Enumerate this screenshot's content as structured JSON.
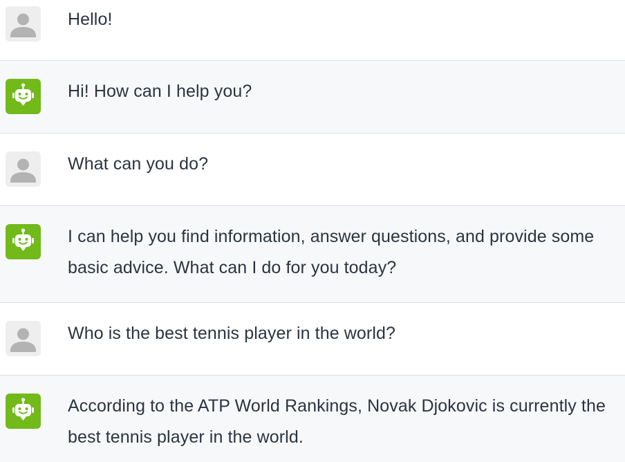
{
  "conversation": {
    "messages": [
      {
        "role": "user",
        "text": "Hello!"
      },
      {
        "role": "bot",
        "text": "Hi! How can I help you?"
      },
      {
        "role": "user",
        "text": "What can you do?"
      },
      {
        "role": "bot",
        "text": "I can help you find information, answer questions, and provide some basic advice. What can I do for you today?"
      },
      {
        "role": "user",
        "text": "Who is the best tennis player in the world?"
      },
      {
        "role": "bot",
        "text": "According to the ATP World Rankings, Novak Djokovic is currently the best tennis player in the world."
      }
    ]
  },
  "icons": {
    "user_avatar": "user-silhouette-icon",
    "bot_avatar": "robot-icon"
  },
  "colors": {
    "bot_avatar_bg": "#72b91a",
    "user_avatar_bg": "#eeeeee",
    "user_silhouette": "#b3b3b3",
    "bot_row_bg": "#f7f8fa",
    "divider": "#d9dde3",
    "text": "#2b3440"
  }
}
